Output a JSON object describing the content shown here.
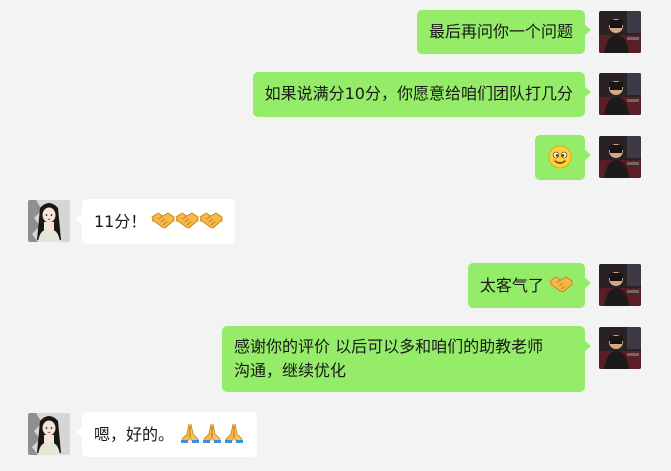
{
  "chat": {
    "messages": [
      {
        "sender": "me",
        "text": "最后再问你一个问题"
      },
      {
        "sender": "me",
        "text": "如果说满分10分，你愿意给咱们团队打几分"
      },
      {
        "sender": "me",
        "emoji": "grinning-squinting-face-emoji"
      },
      {
        "sender": "her",
        "text": "11分！",
        "emoji": [
          "handshake-emoji",
          "handshake-emoji",
          "handshake-emoji"
        ]
      },
      {
        "sender": "me",
        "text": "太客气了",
        "emoji": [
          "handshake-emoji"
        ]
      },
      {
        "sender": "me",
        "lines": [
          "感谢你的评价 以后可以多和咱们的助教老师",
          "沟通，继续优化"
        ]
      },
      {
        "sender": "her",
        "text": "嗯，好的。",
        "emoji": [
          "folded-hands-emoji",
          "folded-hands-emoji",
          "folded-hands-emoji"
        ]
      }
    ]
  },
  "colors": {
    "background": "#f3f3f3",
    "my_bubble": "#95ec69",
    "her_bubble": "#ffffff",
    "text": "#181818"
  },
  "icons": {
    "my_avatar": "man-in-car-avatar",
    "her_avatar": "illustrated-woman-avatar"
  }
}
